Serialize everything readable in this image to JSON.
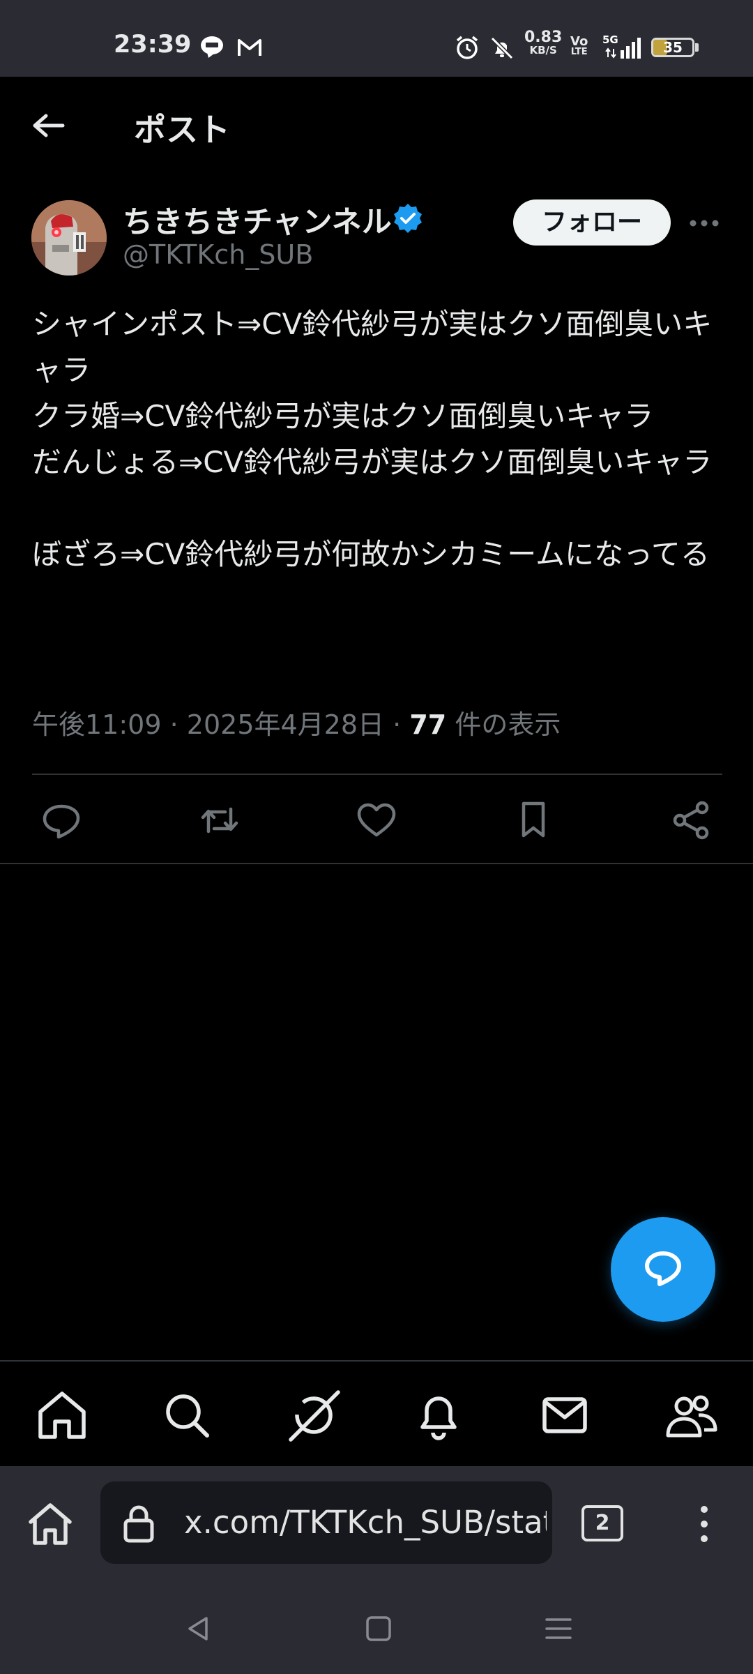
{
  "status_bar": {
    "time": "23:39",
    "net_speed_value": "0.83",
    "net_speed_unit": "KB/S",
    "volte_top": "Vo",
    "volte_bottom": "LTE",
    "network": "5G",
    "battery": "35",
    "battery_level": 0.35
  },
  "header": {
    "title": "ポスト",
    "back_icon": "arrow-left-icon"
  },
  "post": {
    "author_name": "ちきちきチャンネル",
    "author_handle": "@TKTKch_SUB",
    "verified": true,
    "follow_label": "フォロー",
    "text": "シャインポスト⇒CV鈴代紗弓が実はクソ面倒臭いキャラ\nクラ婚⇒CV鈴代紗弓が実はクソ面倒臭いキャラ\nだんじょる⇒CV鈴代紗弓が実はクソ面倒臭いキャラ\n\nぼざろ⇒CV鈴代紗弓が何故かシカミームになってる",
    "time": "午後11:09",
    "separator": "·",
    "date": "2025年4月28日",
    "views": "77",
    "views_label": "件の表示"
  },
  "actions": [
    "reply-icon",
    "repost-icon",
    "like-icon",
    "bookmark-icon",
    "share-icon"
  ],
  "bottom_nav": [
    "home-icon",
    "search-icon",
    "grok-icon",
    "notifications-icon",
    "messages-icon",
    "communities-icon"
  ],
  "browser": {
    "url": "x.com/TKTKch_SUB/status",
    "tabs_count": "2"
  },
  "colors": {
    "accent": "#1d9bf0",
    "background": "#000000",
    "secondary_text": "#71767b",
    "system_bar": "#2a2b33"
  }
}
